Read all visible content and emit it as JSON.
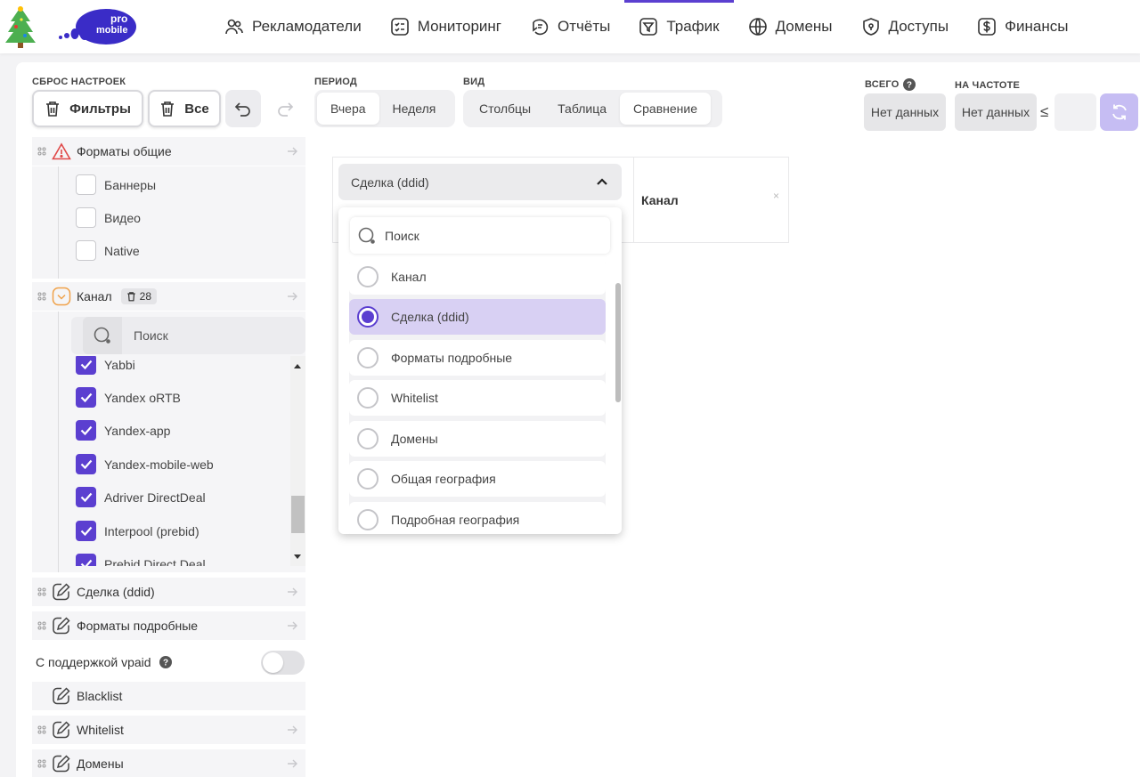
{
  "nav": {
    "logo_top": "pro",
    "logo_bottom": "mobile",
    "items": [
      {
        "label": "Рекламодатели",
        "icon": "users-icon",
        "active": false
      },
      {
        "label": "Мониторинг",
        "icon": "checklist-icon",
        "active": false
      },
      {
        "label": "Отчёты",
        "icon": "reports-icon",
        "active": false
      },
      {
        "label": "Трафик",
        "icon": "funnel-icon",
        "active": true
      },
      {
        "label": "Домены",
        "icon": "globe-icon",
        "active": false
      },
      {
        "label": "Доступы",
        "icon": "shield-icon",
        "active": false
      },
      {
        "label": "Финансы",
        "icon": "dollar-icon",
        "active": false
      }
    ],
    "accent": "#5b3fd0"
  },
  "controls": {
    "reset_label": "Сброс настроек",
    "filters_button": "Фильтры",
    "all_button": "Все",
    "period_label": "Период",
    "period_options": [
      "Вчера",
      "Неделя"
    ],
    "period_selected": "Вчера",
    "view_label": "Вид",
    "view_options": [
      "Столбцы",
      "Таблица",
      "Сравнение"
    ],
    "view_selected": "Сравнение",
    "total_label": "Всего",
    "freq_label": "На частоте",
    "total_value": "Нет данных",
    "freq_value": "Нет данных",
    "le_sign": "≤"
  },
  "sidebar": {
    "formats_general": {
      "title": "Форматы общие",
      "options": [
        {
          "label": "Баннеры",
          "checked": false
        },
        {
          "label": "Видео",
          "checked": false
        },
        {
          "label": "Native",
          "checked": false
        }
      ]
    },
    "channel": {
      "title": "Канал",
      "count": "28",
      "search_placeholder": "Поиск",
      "options": [
        {
          "label": "Yabbi",
          "checked": true
        },
        {
          "label": "Yandex oRTB",
          "checked": true
        },
        {
          "label": "Yandex-app",
          "checked": true
        },
        {
          "label": "Yandex-mobile-web",
          "checked": true
        },
        {
          "label": "Adriver DirectDeal",
          "checked": true
        },
        {
          "label": "Interpool (prebid)",
          "checked": true
        },
        {
          "label": "Prebid Direct Deal",
          "checked": true
        }
      ]
    },
    "deal": "Сделка (ddid)",
    "formats_detailed": "Форматы подробные",
    "vpaid_label": "С поддержкой vpaid",
    "blacklist": "Blacklist",
    "whitelist": "Whitelist",
    "domains": "Домены"
  },
  "compare": {
    "selected": "Сделка (ddid)",
    "column_header": "Канал",
    "remove": "×",
    "search_placeholder": "Поиск",
    "options": [
      {
        "label": "Канал",
        "selected": false
      },
      {
        "label": "Сделка (ddid)",
        "selected": true
      },
      {
        "label": "Форматы подробные",
        "selected": false
      },
      {
        "label": "Whitelist",
        "selected": false
      },
      {
        "label": "Домены",
        "selected": false
      },
      {
        "label": "Общая география",
        "selected": false
      },
      {
        "label": "Подробная география",
        "selected": false
      }
    ]
  }
}
